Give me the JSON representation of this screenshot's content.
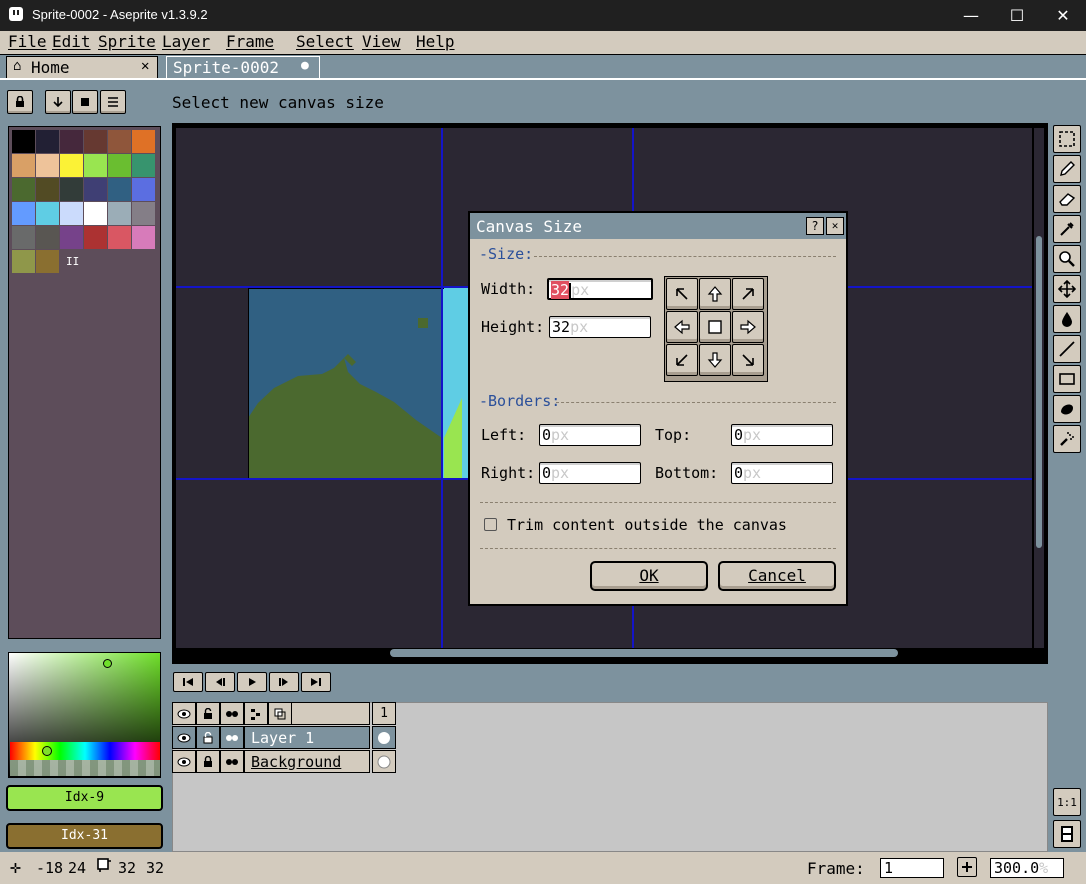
{
  "window": {
    "title": "Sprite-0002 - Aseprite v1.3.9.2",
    "minimize": "—",
    "maximize": "☐",
    "close": "✕"
  },
  "menu": [
    "File",
    "Edit",
    "Sprite",
    "Layer",
    "Frame",
    "Select",
    "View",
    "Help"
  ],
  "tabs": {
    "home": "Home",
    "home_close": "✕",
    "sprite": "Sprite-0002",
    "sprite_dot": "●"
  },
  "status_message": "Select new canvas size",
  "palette": {
    "colors": [
      "#000000",
      "#222034",
      "#45283c",
      "#663931",
      "#8f563b",
      "#df7126",
      "#d9a066",
      "#eec39a",
      "#fbf236",
      "#99e550",
      "#6abe30",
      "#37946e",
      "#4b692f",
      "#524b24",
      "#323c39",
      "#3f3f74",
      "#306082",
      "#5b6ee1",
      "#639bff",
      "#5fcde4",
      "#cbdbfc",
      "#ffffff",
      "#9badb7",
      "#847e87",
      "#696a6a",
      "#595652",
      "#76428a",
      "#ac3232",
      "#d95763",
      "#d77bba",
      "#8f974a",
      "#8a6f30"
    ],
    "pause_glyph": "II"
  },
  "color_buttons": {
    "foreground": "Idx-9",
    "background": "Idx-31",
    "fg_color": "#99e550",
    "bg_color": "#8a6f30"
  },
  "dialog": {
    "title": "Canvas Size",
    "help": "?",
    "close": "✕",
    "size_section": "-Size:",
    "width_label": "Width:",
    "width_value": "32",
    "height_label": "Height:",
    "height_value": "32",
    "unit": "px",
    "borders_section": "-Borders:",
    "left_label": "Left:",
    "left_value": "0",
    "top_label": "Top:",
    "top_value": "0",
    "right_label": "Right:",
    "right_value": "0",
    "bottom_label": "Bottom:",
    "bottom_value": "0",
    "trim_label": "Trim content outside the canvas",
    "ok": "OK",
    "cancel": "Cancel"
  },
  "timeline": {
    "frame_number": "1",
    "layers": [
      {
        "name": "Layer 1"
      },
      {
        "name": "Background"
      }
    ]
  },
  "statusbar": {
    "pos_x": "-18",
    "pos_y": "24",
    "size_w": "32",
    "size_h": "32",
    "frame_label": "Frame:",
    "frame_value": "1",
    "zoom_value": "300.0",
    "zoom_unit": "%"
  },
  "colors": {
    "accent_blue": "#1414c8",
    "dialog_bg": "#d3cbbe",
    "ui_bg": "#7d929e"
  }
}
